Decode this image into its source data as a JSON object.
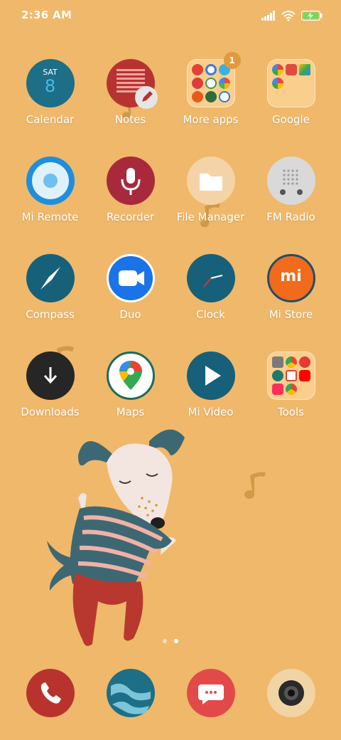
{
  "status": {
    "time": "2:36 AM"
  },
  "apps": {
    "calendar": {
      "label": "Calendar",
      "day": "SAT",
      "date": "8"
    },
    "notes": {
      "label": "Notes"
    },
    "more_apps": {
      "label": "More apps",
      "badge": "1"
    },
    "google": {
      "label": "Google"
    },
    "mi_remote": {
      "label": "Mi Remote"
    },
    "recorder": {
      "label": "Recorder"
    },
    "file_manager": {
      "label": "File Manager"
    },
    "fm_radio": {
      "label": "FM Radio"
    },
    "compass": {
      "label": "Compass"
    },
    "duo": {
      "label": "Duo"
    },
    "clock": {
      "label": "Clock"
    },
    "mi_store": {
      "label": "Mi Store",
      "logo": "mi"
    },
    "downloads": {
      "label": "Downloads"
    },
    "maps": {
      "label": "Maps"
    },
    "mi_video": {
      "label": "Mi Video"
    },
    "tools": {
      "label": "Tools"
    }
  },
  "pages": {
    "count": 2,
    "active": 2
  },
  "dock": [
    "phone-icon",
    "browser-icon",
    "messages-icon",
    "camera-icon"
  ]
}
